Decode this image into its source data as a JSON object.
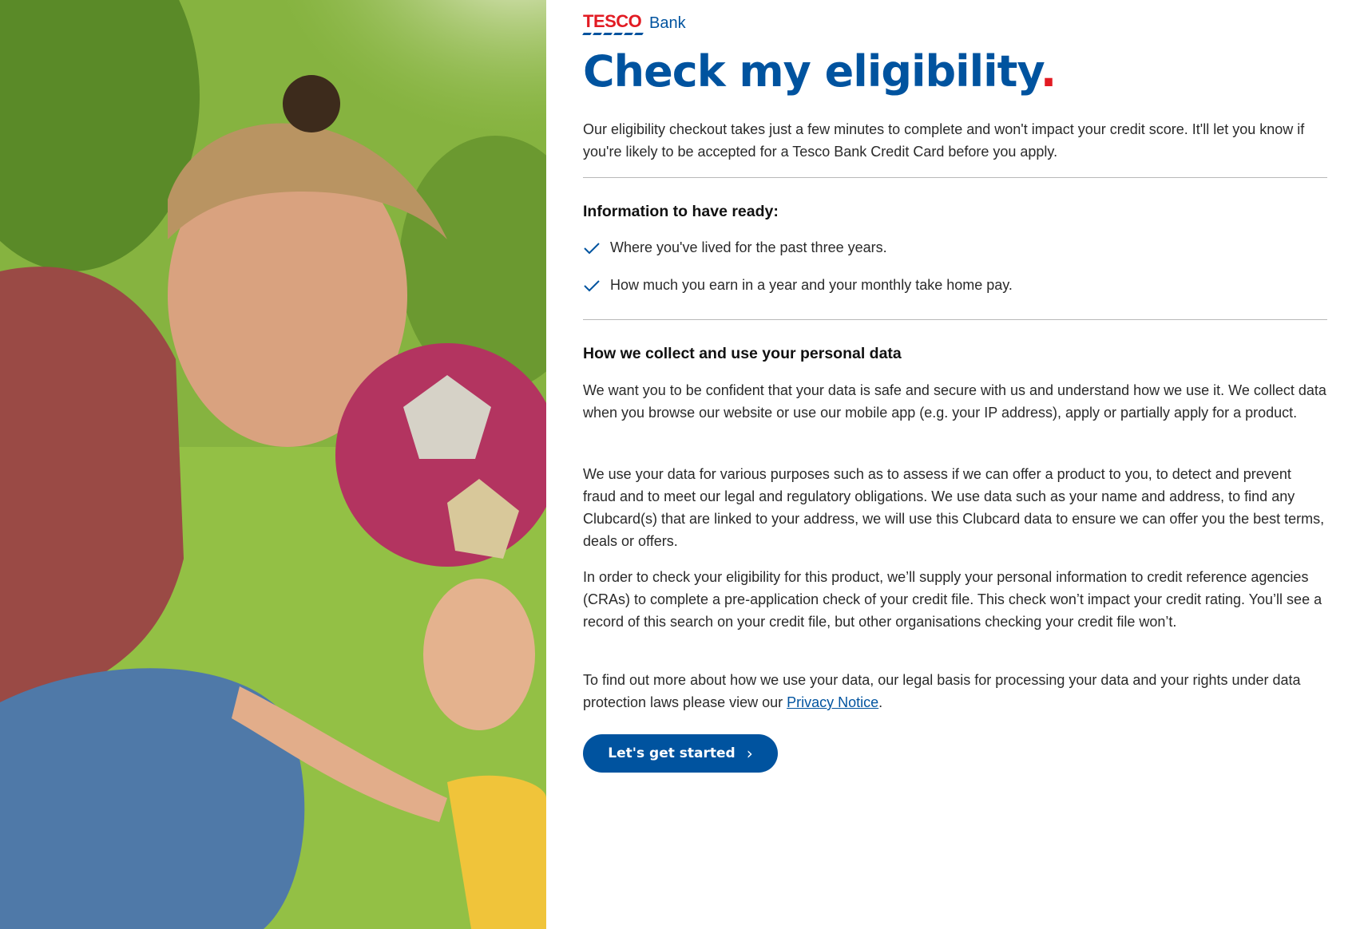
{
  "brand": {
    "logo_wordmark": "TESCO",
    "logo_suffix": "Bank",
    "colors": {
      "blue": "#00539f",
      "red": "#e21b23"
    }
  },
  "page": {
    "title": "Check my eligibility",
    "title_dot": ".",
    "intro": "Our eligibility checkout takes just a few minutes to complete and won't impact your credit score. It'll let you know if you're likely to be accepted for a Tesco Bank Credit Card before you apply."
  },
  "info_section": {
    "heading": "Information to have ready:",
    "items": [
      "Where you've lived for the past three years.",
      "How much you earn in a year and your monthly take home pay."
    ]
  },
  "data_section": {
    "heading": "How we collect and use your personal data",
    "paragraphs": [
      "We want you to be confident that your data is safe and secure with us and understand how we use it. We collect data when you browse our website or use our mobile app (e.g. your IP address), apply or partially apply for a product.",
      "We use your data for various purposes such as to assess if we can offer a product to you, to detect and prevent fraud and to meet our legal and regulatory obligations. We use data such as your name and address, to find any Clubcard(s) that are linked to your address, we will use this Clubcard data to ensure we can offer you the best terms, deals or offers.",
      "In order to check your eligibility for this product, we’ll supply your personal information to credit reference agencies (CRAs) to complete a pre-application check of your credit file. This check won’t impact your credit rating. You’ll see a record of this search on your credit file, but other organisations checking your credit file won’t."
    ],
    "privacy_prefix": "To find out more about how we use your data, our legal basis for processing your data and your rights under data protection laws please view our ",
    "privacy_link": "Privacy Notice",
    "privacy_suffix": "."
  },
  "cta": {
    "label": "Let's get started",
    "icon": "chevron-right-icon"
  }
}
